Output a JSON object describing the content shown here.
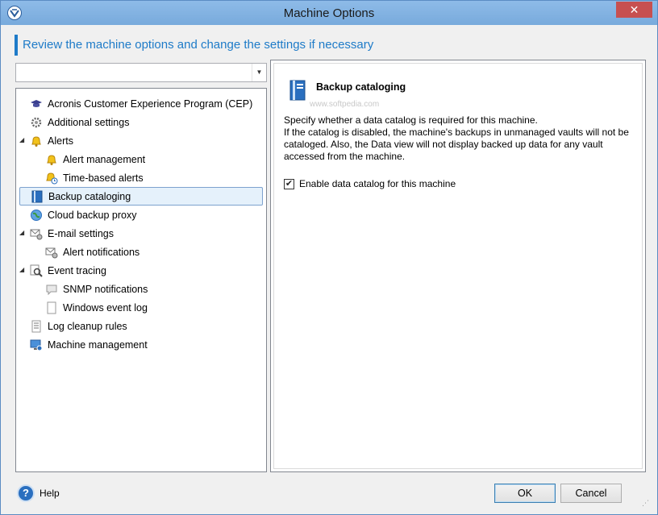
{
  "window": {
    "title": "Machine Options",
    "close_label": "✕"
  },
  "header": {
    "text": "Review the machine options and change the settings if necessary"
  },
  "search": {
    "value": ""
  },
  "tree": {
    "items": [
      {
        "label": "Acronis Customer Experience Program (CEP)",
        "icon": "graduation-cap-icon",
        "level": 0,
        "expander": ""
      },
      {
        "label": "Additional settings",
        "icon": "gears-icon",
        "level": 0,
        "expander": ""
      },
      {
        "label": "Alerts",
        "icon": "bell-icon",
        "level": 0,
        "expander": "◢"
      },
      {
        "label": "Alert management",
        "icon": "bell-icon",
        "level": 1,
        "expander": ""
      },
      {
        "label": "Time-based alerts",
        "icon": "bell-clock-icon",
        "level": 1,
        "expander": ""
      },
      {
        "label": "Backup cataloging",
        "icon": "catalog-book-icon",
        "level": 0,
        "expander": "",
        "selected": true
      },
      {
        "label": "Cloud backup proxy",
        "icon": "globe-icon",
        "level": 0,
        "expander": ""
      },
      {
        "label": "E-mail settings",
        "icon": "email-gear-icon",
        "level": 0,
        "expander": "◢"
      },
      {
        "label": "Alert notifications",
        "icon": "email-gear-icon",
        "level": 1,
        "expander": ""
      },
      {
        "label": "Event tracing",
        "icon": "magnifier-icon",
        "level": 0,
        "expander": "◢"
      },
      {
        "label": "SNMP notifications",
        "icon": "speech-bubble-icon",
        "level": 1,
        "expander": ""
      },
      {
        "label": "Windows event log",
        "icon": "document-icon",
        "level": 1,
        "expander": ""
      },
      {
        "label": "Log cleanup rules",
        "icon": "list-document-icon",
        "level": 0,
        "expander": ""
      },
      {
        "label": "Machine management",
        "icon": "monitor-icon",
        "level": 0,
        "expander": ""
      }
    ]
  },
  "option": {
    "title": "Backup cataloging",
    "watermark": "www.softpedia.com",
    "description": [
      "Specify whether a data catalog is required for this machine.",
      "If the catalog is disabled, the machine's backups in unmanaged vaults will not be",
      "cataloged. Also, the Data view will not display backed up data for any vault",
      "accessed from the machine."
    ],
    "checkbox_label": "Enable data catalog for this machine",
    "checkbox_checked": true
  },
  "footer": {
    "help_label": "Help",
    "ok_label": "OK",
    "cancel_label": "Cancel"
  },
  "colors": {
    "accent": "#1e7bc8",
    "selection_bg": "#e5f1fb",
    "titlebar": "#7fb0e2",
    "close": "#c75050"
  }
}
